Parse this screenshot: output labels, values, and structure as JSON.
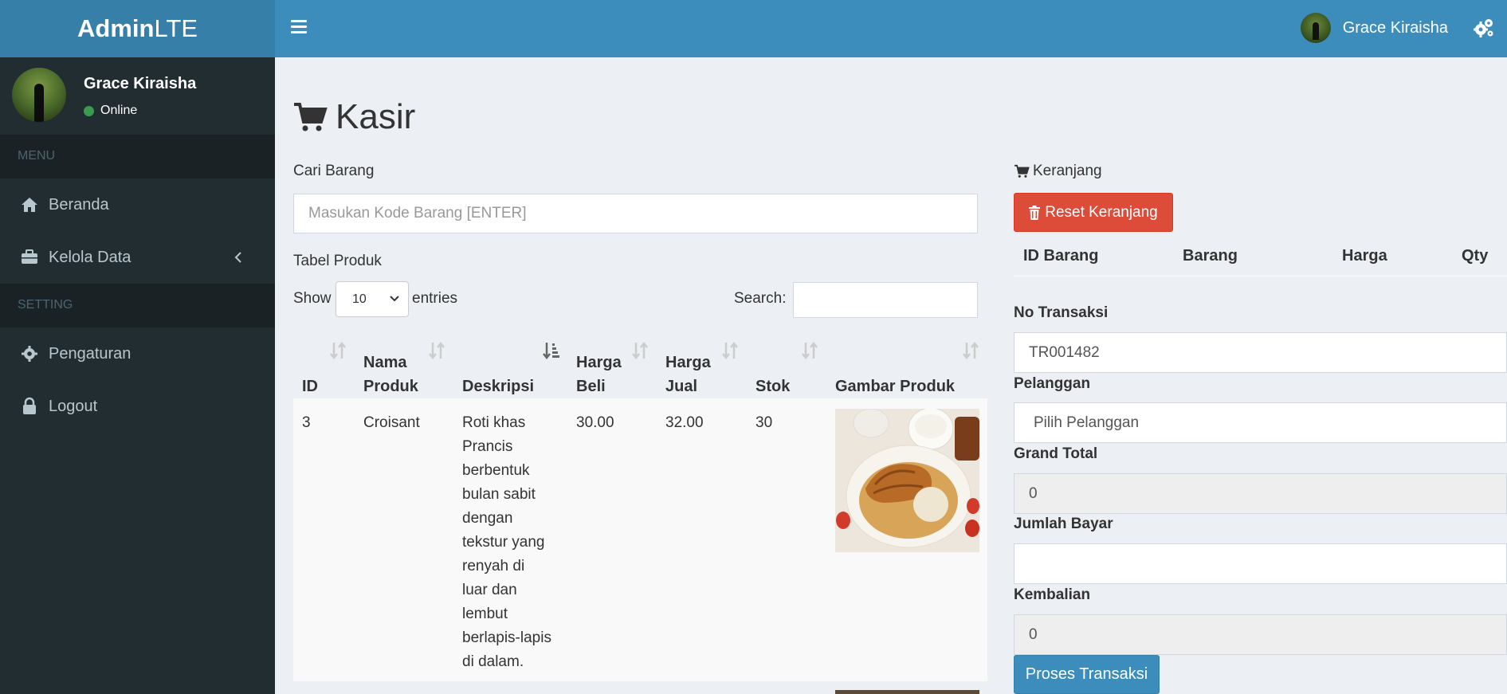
{
  "header": {
    "logo_bold": "Admin",
    "logo_light": "LTE",
    "user_name": "Grace Kiraisha"
  },
  "sidebar": {
    "user_name": "Grace Kiraisha",
    "status": "Online",
    "sections": [
      {
        "title": "MENU"
      },
      {
        "title": "SETTING"
      }
    ],
    "items": [
      {
        "label": "Beranda",
        "icon": "home-icon"
      },
      {
        "label": "Kelola Data",
        "icon": "briefcase-icon"
      },
      {
        "label": "Pengaturan",
        "icon": "gear-icon"
      },
      {
        "label": "Logout",
        "icon": "lock-icon"
      }
    ]
  },
  "page": {
    "title": "Kasir",
    "search_label": "Cari Barang",
    "search_placeholder": "Masukan Kode Barang [ENTER]",
    "table_label": "Tabel Produk",
    "show_label": "Show",
    "entries_value": "10",
    "entries_label": "entries",
    "search_table_label": "Search:"
  },
  "table": {
    "columns": [
      {
        "line1": "",
        "line2": "ID"
      },
      {
        "line1": "Nama",
        "line2": "Produk"
      },
      {
        "line1": "",
        "line2": "Deskripsi"
      },
      {
        "line1": "Harga",
        "line2": "Beli"
      },
      {
        "line1": "Harga",
        "line2": "Jual"
      },
      {
        "line1": "",
        "line2": "Stok"
      },
      {
        "line1": "",
        "line2": "Gambar Produk"
      }
    ],
    "rows": [
      {
        "id": "3",
        "nama": "Croisant",
        "deskripsi": [
          "Roti khas",
          "Prancis",
          "berbentuk",
          "bulan sabit",
          "dengan",
          "tekstur yang",
          "renyah di",
          "luar dan",
          "lembut",
          "berlapis-lapis",
          "di dalam."
        ],
        "harga_beli": "30.00",
        "harga_jual": "32.00",
        "stok": "30"
      }
    ]
  },
  "cart": {
    "title": "Keranjang",
    "reset_label": "Reset Keranjang",
    "columns": [
      "ID Barang",
      "Barang",
      "Harga",
      "Qty"
    ],
    "no_transaksi_label": "No Transaksi",
    "no_transaksi_value": "TR001482",
    "pelanggan_label": "Pelanggan",
    "pelanggan_value": "Pilih Pelanggan",
    "grand_total_label": "Grand Total",
    "grand_total_value": "0",
    "jumlah_bayar_label": "Jumlah Bayar",
    "jumlah_bayar_value": "",
    "kembalian_label": "Kembalian",
    "kembalian_value": "0",
    "proses_label": "Proses Transaksi"
  },
  "colors": {
    "header": "#3c8dbc",
    "logo_bg": "#367fa9",
    "sidebar": "#222d32",
    "danger": "#dd4b39",
    "online": "#3c9a4e"
  }
}
